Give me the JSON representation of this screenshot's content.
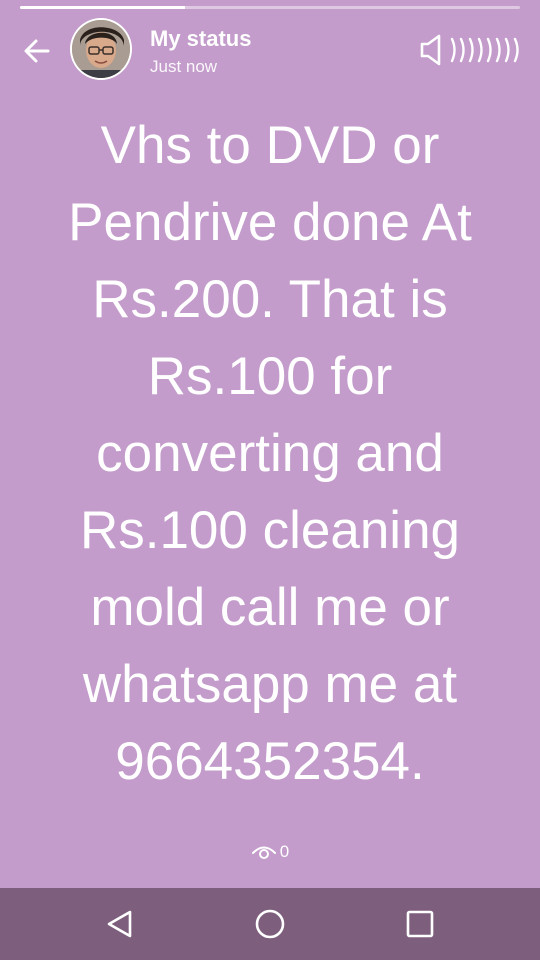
{
  "status": {
    "title": "My status",
    "time": "Just now",
    "progress_fraction": 0.33,
    "message_lines": [
      "Vhs to DVD or",
      "Pendrive done At",
      "Rs.200. That is",
      "Rs.100 for",
      "converting and",
      "Rs.100 cleaning",
      "mold call me or",
      "whatsapp me at",
      "9664352354."
    ],
    "view_count": "0"
  },
  "icons": {
    "back": "back-arrow-icon",
    "speaker": "speaker-icon",
    "views": "eye-icon",
    "nav_back": "triangle-back-icon",
    "nav_home": "circle-home-icon",
    "nav_recents": "square-recents-icon"
  },
  "colors": {
    "background": "#c39ccb",
    "navbar": "#7d5f7d",
    "text": "#ffffff"
  }
}
